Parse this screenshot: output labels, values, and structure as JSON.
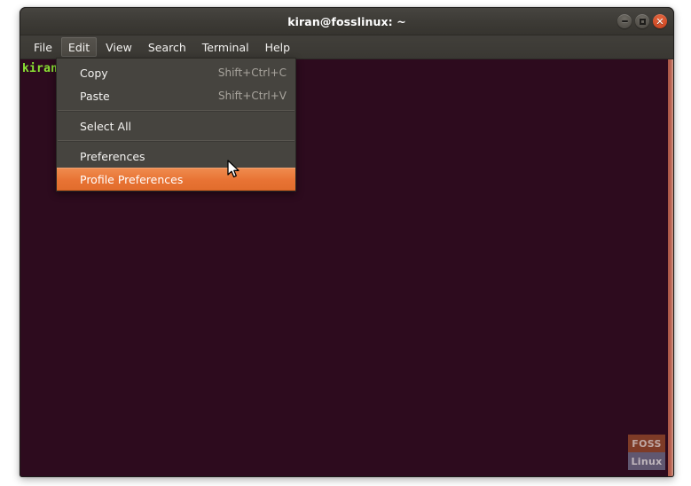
{
  "window": {
    "title": "kiran@fosslinux: ~",
    "controls": [
      {
        "name": "minimize",
        "glyph": "–"
      },
      {
        "name": "maximize",
        "glyph": "□"
      },
      {
        "name": "close",
        "glyph": "✕"
      }
    ]
  },
  "menubar": {
    "items": [
      {
        "label": "File",
        "active": false
      },
      {
        "label": "Edit",
        "active": true
      },
      {
        "label": "View",
        "active": false
      },
      {
        "label": "Search",
        "active": false
      },
      {
        "label": "Terminal",
        "active": false
      },
      {
        "label": "Help",
        "active": false
      }
    ]
  },
  "dropdown": {
    "owner": "Edit",
    "items": [
      {
        "label": "Copy",
        "accel": "Shift+Ctrl+C",
        "highlighted": false,
        "separator_after": false
      },
      {
        "label": "Paste",
        "accel": "Shift+Ctrl+V",
        "highlighted": false,
        "separator_after": true
      },
      {
        "label": "Select All",
        "accel": "",
        "highlighted": false,
        "separator_after": true
      },
      {
        "label": "Preferences",
        "accel": "",
        "highlighted": false,
        "separator_after": false
      },
      {
        "label": "Profile Preferences",
        "accel": "",
        "highlighted": true,
        "separator_after": false
      }
    ]
  },
  "terminal": {
    "prompt_text": "kiran@fosslinux:~$",
    "background_color": "#2d0b1e",
    "prompt_color": "#8ae234"
  },
  "watermark": {
    "line1": "FOSS",
    "line2": "Linux"
  },
  "colors": {
    "accent_orange": "#e87334",
    "titlebar": "#3d3b36",
    "menu_background": "#46443f",
    "terminal_background": "#2d0b1e",
    "prompt_green": "#8ae234"
  }
}
